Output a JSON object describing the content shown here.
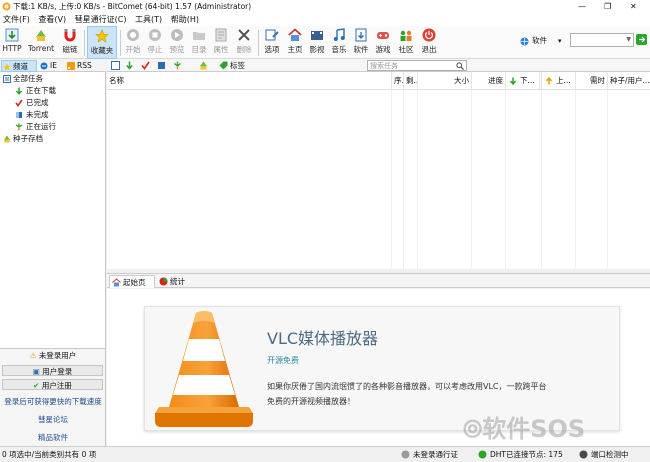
{
  "title": "下载:1 KB/s, 上传:0 KB/s - BitComet (64-bit) 1.57 (Administrator)",
  "window_controls": {
    "minimize": "—",
    "restore": "❐",
    "close": "✕"
  },
  "menu": [
    "文件(F)",
    "查看(V)",
    "彗星通行证(C)",
    "工具(T)",
    "帮助(H)"
  ],
  "toolbar": {
    "http": "HTTP",
    "torrent": "Torrent",
    "magnet": "磁链",
    "favorites": "收藏夹",
    "start": "开始",
    "stop": "停止",
    "preview": "预览",
    "dir": "目录",
    "props": "属性",
    "delete": "删除",
    "options": "选项",
    "home": "主页",
    "video": "影视",
    "music": "音乐",
    "software": "软件",
    "games": "游戏",
    "community": "社区",
    "exit": "退出",
    "search_category": "软件",
    "search_value": ""
  },
  "left": {
    "tabs": [
      "频道",
      "IE",
      "RSS"
    ],
    "tree": [
      "全部任务",
      "正在下载",
      "已完成",
      "未完成",
      "正在运行",
      "种子存档"
    ]
  },
  "panel": {
    "not_logged": "未登录用户",
    "login": "用户登录",
    "register": "用户注册",
    "hint": "登录后可获得更快的下载速度",
    "forum": "彗星论坛",
    "premium": "精品软件"
  },
  "subtoolbar": {
    "tags": "标签",
    "search_placeholder": "搜索任务"
  },
  "columns": [
    "名称",
    "序...",
    "剩...",
    "大小",
    "进度",
    "下...",
    "上...",
    "需时",
    "种子/用户..."
  ],
  "bottom_tabs": [
    "起始页",
    "统计"
  ],
  "promo": {
    "title": "VLC媒体播放器",
    "subtitle": "开源免费",
    "desc_line1": "如果你厌倦了国内流氓惯了的各种影音播放器，可以考虑改用VLC，一款跨平台",
    "desc_line2": "免费的开源视频播放器！"
  },
  "watermark": "软件SOS",
  "status": {
    "left": "0 项选中/当前类别共有 0 项",
    "user": "未登录通行证",
    "dht": "DHT已连接节点: 175",
    "port": "端口检测中"
  },
  "colors": {
    "accent": "#1e73c8",
    "selected_bg": "#cce4f7",
    "promo_title": "#4a6a86",
    "green": "#2aa52a"
  }
}
